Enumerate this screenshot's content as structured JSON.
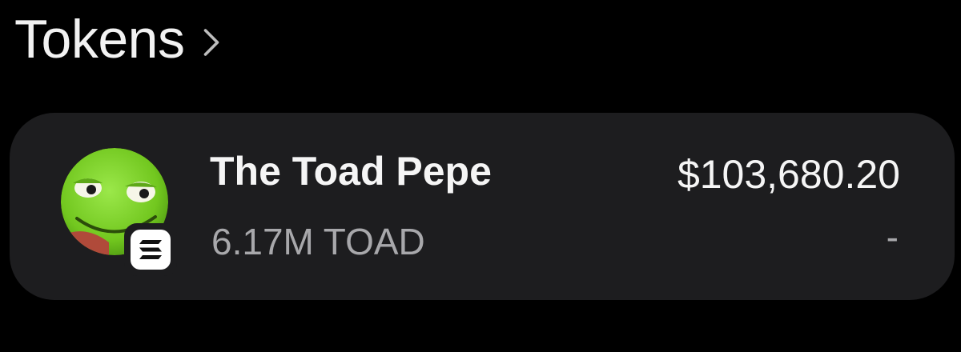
{
  "header": {
    "title": "Tokens",
    "chevron_icon": "chevron-right-icon"
  },
  "token": {
    "name": "The Toad Pepe",
    "amount": "6.17M TOAD",
    "value": "$103,680.20",
    "change": "-",
    "avatar_icon": "toad-pepe-avatar",
    "chain_icon": "solana-icon"
  },
  "colors": {
    "background": "#000000",
    "card": "#1d1d1f",
    "primary_text": "#f5f5f5",
    "secondary_text": "#a8a8ab",
    "avatar_green": "#7ed321"
  }
}
